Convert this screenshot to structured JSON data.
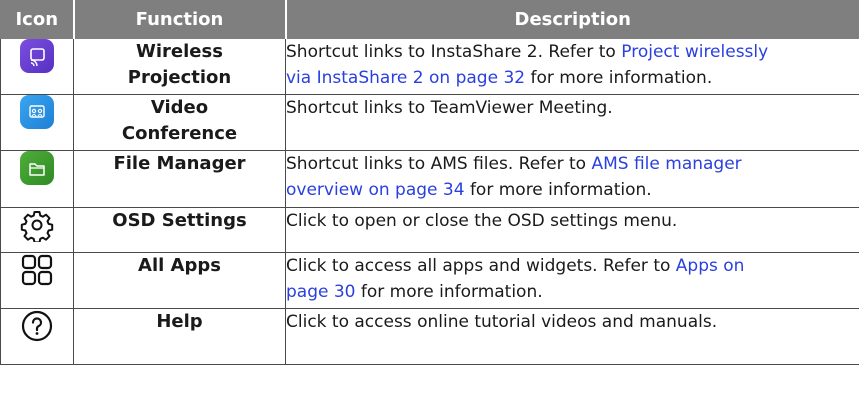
{
  "header": {
    "icon": "Icon",
    "function": "Function",
    "description": "Description"
  },
  "rows": [
    {
      "icon": "wireless-projection-icon",
      "icon_color": "#6a3fd0",
      "fn1": "Wireless",
      "fn2": "Projection",
      "d1": "Shortcut links to InstaShare 2. Refer to ",
      "link1": "Project wirelessly",
      "link2": "via InstaShare 2 on page 32",
      "d2": " for more information."
    },
    {
      "icon": "video-conference-icon",
      "icon_color": "#2a8fe6",
      "fn1": "Video",
      "fn2": "Conference",
      "d1": "Shortcut links to TeamViewer Meeting."
    },
    {
      "icon": "file-manager-icon",
      "icon_color": "#3c9a2e",
      "fn1": "File Manager",
      "d1": "Shortcut links to AMS files. Refer to ",
      "link1": "AMS file manager",
      "link2": "overview on page 34",
      "d2": " for more information."
    },
    {
      "icon": "gear-icon",
      "fn1": "OSD Settings",
      "d1": "Click to open or close the OSD settings menu."
    },
    {
      "icon": "grid-apps-icon",
      "fn1": "All Apps",
      "d1": "Click to access all apps and widgets. Refer to ",
      "link1": "Apps on",
      "link2": "page 30",
      "d2": " for more information."
    },
    {
      "icon": "help-icon",
      "fn1": "Help",
      "d1": "Click to access online tutorial videos and manuals."
    }
  ],
  "colors": {
    "header_bg": "#7f7f7f",
    "link": "#2a3fe0",
    "border": "#4a4a4a"
  }
}
